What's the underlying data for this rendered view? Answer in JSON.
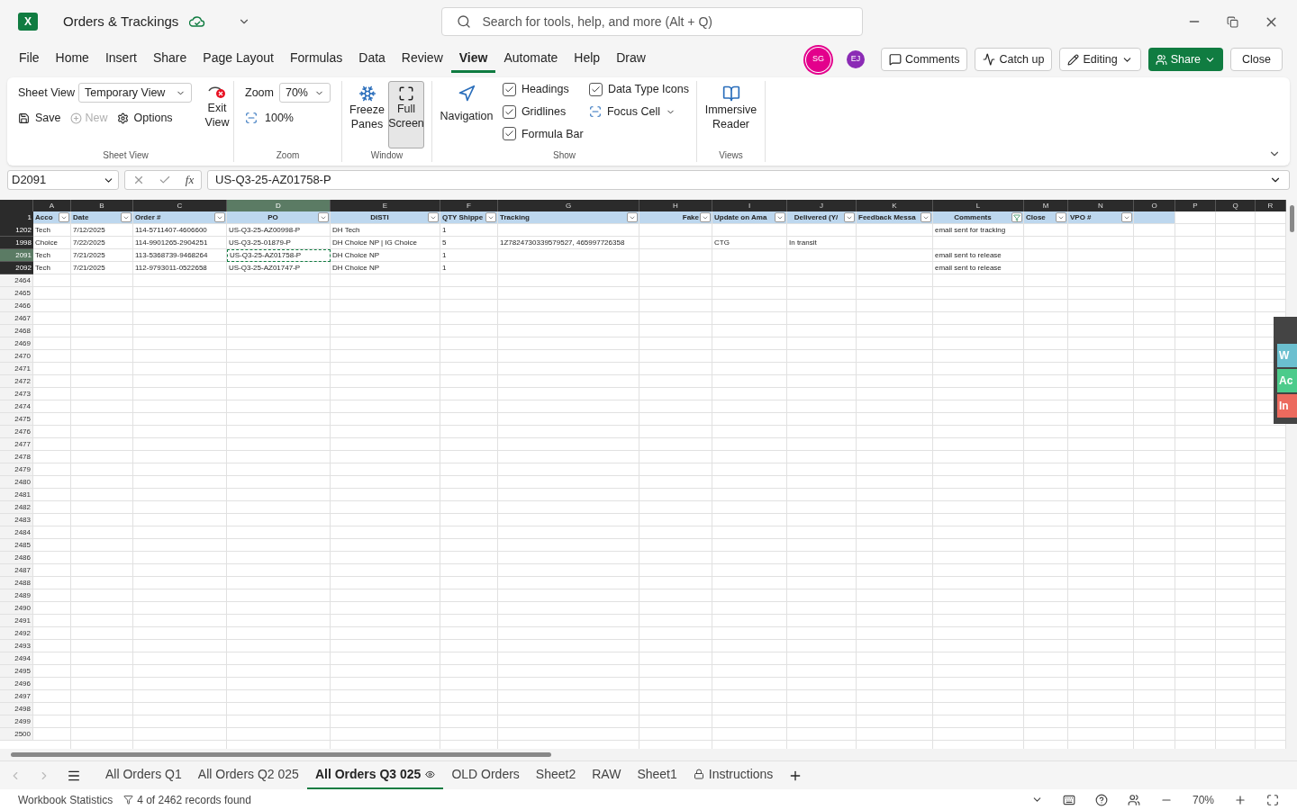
{
  "title_bar": {
    "app": "X",
    "title": "Orders & Trackings",
    "search": {
      "placeholder": "Search for tools, help, and more (Alt + Q)"
    }
  },
  "menu": [
    {
      "label": "File",
      "selected": false
    },
    {
      "label": "Home",
      "selected": false
    },
    {
      "label": "Insert",
      "selected": false
    },
    {
      "label": "Share",
      "selected": false
    },
    {
      "label": "Page Layout",
      "selected": false
    },
    {
      "label": "Formulas",
      "selected": false
    },
    {
      "label": "Data",
      "selected": false
    },
    {
      "label": "Review",
      "selected": false
    },
    {
      "label": "View",
      "selected": true
    },
    {
      "label": "Automate",
      "selected": false
    },
    {
      "label": "Help",
      "selected": false
    },
    {
      "label": "Draw",
      "selected": false
    }
  ],
  "collaborators": [
    {
      "initials": "SG",
      "color": "#e3008c"
    },
    {
      "initials": "EJ",
      "color": "#8b2bb5"
    }
  ],
  "actions": {
    "comments": "Comments",
    "catch_up": "Catch up",
    "editing": "Editing",
    "share": "Share",
    "close": "Close"
  },
  "ribbon": {
    "sheet_view": {
      "label": "Sheet View",
      "dropdown": "Temporary View",
      "save": "Save",
      "new": {
        "label": "New",
        "disabled": true
      },
      "options": "Options",
      "exit": "Exit View",
      "group": "Sheet View"
    },
    "zoom": {
      "label": "Zoom",
      "value": "70%",
      "reset": "100%",
      "group": "Zoom"
    },
    "window": {
      "freeze": "Freeze Panes",
      "full_screen": {
        "label": "Full Screen",
        "on": true
      },
      "group": "Window"
    },
    "show": {
      "navigation": "Navigation",
      "checks": [
        {
          "label": "Headings",
          "checked": true
        },
        {
          "label": "Gridlines",
          "checked": true
        },
        {
          "label": "Formula Bar",
          "checked": true
        },
        {
          "label": "Data Type Icons",
          "checked": true
        }
      ],
      "focus_cell": "Focus Cell",
      "group": "Show"
    },
    "views": {
      "reader": "Immersive Reader",
      "group": "Views"
    }
  },
  "formula_bar": {
    "name_box": "D2091",
    "function_label": "fx",
    "value": "US-Q3-25-AZ01758-P"
  },
  "columns": [
    {
      "letter": "A",
      "selected": false
    },
    {
      "letter": "B",
      "selected": false
    },
    {
      "letter": "C",
      "selected": false
    },
    {
      "letter": "D",
      "selected": true
    },
    {
      "letter": "E",
      "selected": false
    },
    {
      "letter": "F",
      "selected": false
    },
    {
      "letter": "G",
      "selected": false
    },
    {
      "letter": "H",
      "selected": false
    },
    {
      "letter": "I",
      "selected": false
    },
    {
      "letter": "J",
      "selected": false
    },
    {
      "letter": "K",
      "selected": false
    },
    {
      "letter": "L",
      "selected": false
    },
    {
      "letter": "M",
      "selected": false
    },
    {
      "letter": "N",
      "selected": false
    },
    {
      "letter": "O",
      "selected": false
    },
    {
      "letter": "P",
      "selected": false
    },
    {
      "letter": "Q",
      "selected": false
    },
    {
      "letter": "R",
      "selected": false
    }
  ],
  "header_row": {
    "number": "1",
    "cells": [
      {
        "text": "Acco",
        "filtered": false
      },
      {
        "text": "Date",
        "filtered": false
      },
      {
        "text": "Order #",
        "filtered": false
      },
      {
        "text": "PO",
        "filtered": false
      },
      {
        "text": "DISTI",
        "filtered": false
      },
      {
        "text": "QTY Shippe",
        "filtered": false
      },
      {
        "text": "Tracking",
        "filtered": false
      },
      {
        "text": "Fake",
        "filtered": false
      },
      {
        "text": "Update on Ama",
        "filtered": false
      },
      {
        "text": "Delivered (Y/",
        "filtered": false
      },
      {
        "text": "Feedback Messa",
        "filtered": false
      },
      {
        "text": "Comments",
        "filtered": true
      },
      {
        "text": "Close",
        "filtered": false
      },
      {
        "text": "VPO #",
        "filtered": false
      }
    ]
  },
  "rows": [
    {
      "number": "1202",
      "filtered": true,
      "selected": false,
      "cells": [
        "Tech",
        "7/12/2025",
        "114-5711407-4606600",
        "US-Q3-25-AZ00998-P",
        "DH Tech",
        "1",
        null,
        null,
        null,
        null,
        null,
        "email sent for tracking"
      ]
    },
    {
      "number": "1998",
      "filtered": true,
      "selected": false,
      "cells": [
        "Choice",
        "7/22/2025",
        "114-9901265-2904251",
        "US-Q3-25-01879-P",
        "DH Choice NP | IG Choice",
        "5",
        "1Z7824730339579527, 465997726358",
        null,
        "CTG",
        "In transit"
      ]
    },
    {
      "number": "2091",
      "filtered": true,
      "selected": true,
      "cells": [
        "Tech",
        "7/21/2025",
        "113-5368739-9468264",
        "US-Q3-25-AZ01758-P",
        "DH Choice NP",
        "1",
        null,
        null,
        null,
        null,
        null,
        "email sent to release"
      ]
    },
    {
      "number": "2092",
      "filtered": true,
      "selected": false,
      "cells": [
        "Tech",
        "7/21/2025",
        "112-9793011-0522658",
        "US-Q3-25-AZ01747-P",
        "DH Choice NP",
        "1",
        null,
        null,
        null,
        null,
        null,
        "email sent to release"
      ]
    },
    {
      "number": "2464",
      "filtered": false,
      "selected": false
    },
    {
      "number": "2465",
      "filtered": false,
      "selected": false
    },
    {
      "number": "2466",
      "filtered": false,
      "selected": false
    },
    {
      "number": "2467",
      "filtered": false,
      "selected": false
    },
    {
      "number": "2468",
      "filtered": false,
      "selected": false
    },
    {
      "number": "2469",
      "filtered": false,
      "selected": false
    },
    {
      "number": "2470",
      "filtered": false,
      "selected": false
    },
    {
      "number": "2471",
      "filtered": false,
      "selected": false
    },
    {
      "number": "2472",
      "filtered": false,
      "selected": false
    },
    {
      "number": "2473",
      "filtered": false,
      "selected": false
    },
    {
      "number": "2474",
      "filtered": false,
      "selected": false
    },
    {
      "number": "2475",
      "filtered": false,
      "selected": false
    },
    {
      "number": "2476",
      "filtered": false,
      "selected": false
    },
    {
      "number": "2477",
      "filtered": false,
      "selected": false
    },
    {
      "number": "2478",
      "filtered": false,
      "selected": false
    },
    {
      "number": "2479",
      "filtered": false,
      "selected": false
    },
    {
      "number": "2480",
      "filtered": false,
      "selected": false
    },
    {
      "number": "2481",
      "filtered": false,
      "selected": false
    },
    {
      "number": "2482",
      "filtered": false,
      "selected": false
    },
    {
      "number": "2483",
      "filtered": false,
      "selected": false
    },
    {
      "number": "2484",
      "filtered": false,
      "selected": false
    },
    {
      "number": "2485",
      "filtered": false,
      "selected": false
    },
    {
      "number": "2486",
      "filtered": false,
      "selected": false
    },
    {
      "number": "2487",
      "filtered": false,
      "selected": false
    },
    {
      "number": "2488",
      "filtered": false,
      "selected": false
    },
    {
      "number": "2489",
      "filtered": false,
      "selected": false
    },
    {
      "number": "2490",
      "filtered": false,
      "selected": false
    },
    {
      "number": "2491",
      "filtered": false,
      "selected": false
    },
    {
      "number": "2492",
      "filtered": false,
      "selected": false
    },
    {
      "number": "2493",
      "filtered": false,
      "selected": false
    },
    {
      "number": "2494",
      "filtered": false,
      "selected": false
    },
    {
      "number": "2495",
      "filtered": false,
      "selected": false
    },
    {
      "number": "2496",
      "filtered": false,
      "selected": false
    },
    {
      "number": "2497",
      "filtered": false,
      "selected": false
    },
    {
      "number": "2498",
      "filtered": false,
      "selected": false
    },
    {
      "number": "2499",
      "filtered": false,
      "selected": false
    },
    {
      "number": "2500",
      "filtered": false,
      "selected": false
    }
  ],
  "side_panel": [
    {
      "label": "W",
      "color": "#6bbfcf"
    },
    {
      "label": "Ac",
      "color": "#4ccb8b"
    },
    {
      "label": "In",
      "color": "#ec6a5e"
    }
  ],
  "sheet_tabs": [
    {
      "label": "All Orders Q1",
      "selected": false,
      "kind": "plain"
    },
    {
      "label": "All Orders Q2 025",
      "selected": false,
      "kind": "plain"
    },
    {
      "label": "All Orders Q3 025",
      "selected": true,
      "kind": "watched"
    },
    {
      "label": "OLD Orders",
      "selected": false,
      "kind": "plain"
    },
    {
      "label": "Sheet2",
      "selected": false,
      "kind": "plain"
    },
    {
      "label": "RAW",
      "selected": false,
      "kind": "plain"
    },
    {
      "label": "Sheet1",
      "selected": false,
      "kind": "plain"
    },
    {
      "label": "Instructions",
      "selected": false,
      "kind": "locked"
    }
  ],
  "status_bar": {
    "statistics": "Workbook Statistics",
    "records": "4 of 2462 records found",
    "zoom": "70%"
  }
}
